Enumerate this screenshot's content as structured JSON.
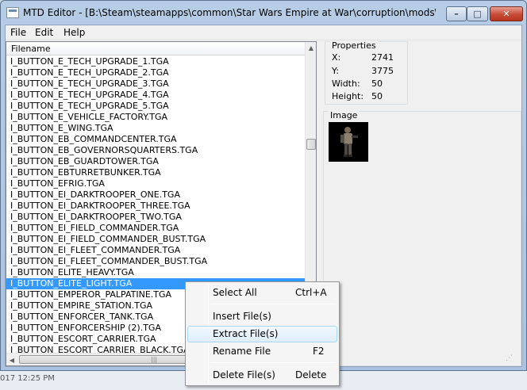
{
  "window": {
    "title": "MTD Editor -  [B:\\Steam\\steamapps\\common\\Star Wars Empire at War\\corruption\\mods\\Star_W...",
    "minimize_glyph": "–",
    "maximize_glyph": "□",
    "close_glyph": "✕"
  },
  "menu": {
    "file": "File",
    "edit": "Edit",
    "help": "Help"
  },
  "file_list": {
    "header": "Filename",
    "rows": [
      "I_BUTTON_E_TECH_UPGRADE_1.TGA",
      "I_BUTTON_E_TECH_UPGRADE_2.TGA",
      "I_BUTTON_E_TECH_UPGRADE_3.TGA",
      "I_BUTTON_E_TECH_UPGRADE_4.TGA",
      "I_BUTTON_E_TECH_UPGRADE_5.TGA",
      "I_BUTTON_E_VEHICLE_FACTORY.TGA",
      "I_BUTTON_E_WING.TGA",
      "I_BUTTON_EB_COMMANDCENTER.TGA",
      "I_BUTTON_EB_GOVERNORSQUARTERS.TGA",
      "I_BUTTON_EB_GUARDTOWER.TGA",
      "I_BUTTON_EBTURRETBUNKER.TGA",
      "I_BUTTON_EFRIG.TGA",
      "I_BUTTON_EI_DARKTROOPER_ONE.TGA",
      "I_BUTTON_EI_DARKTROOPER_THREE.TGA",
      "I_BUTTON_EI_DARKTROOPER_TWO.TGA",
      "I_BUTTON_EI_FIELD_COMMANDER.TGA",
      "I_BUTTON_EI_FIELD_COMMANDER_BUST.TGA",
      "I_BUTTON_EI_FLEET_COMMANDER.TGA",
      "I_BUTTON_EI_FLEET_COMMANDER_BUST.TGA",
      "I_BUTTON_ELITE_HEAVY.TGA",
      "I_BUTTON_ELITE_LIGHT.TGA",
      "I_BUTTON_EMPEROR_PALPATINE.TGA",
      "I_BUTTON_EMPIRE_STATION.TGA",
      "I_BUTTON_ENFORCER_TANK.TGA",
      "I_BUTTON_ENFORCERSHIP (2).TGA",
      "I_BUTTON_ESCORT_CARRIER.TGA",
      "I_BUTTON_ESCORT_CARRIER_BLACK.TGA"
    ],
    "selected_index": 20
  },
  "properties": {
    "legend": "Properties",
    "x_label": "X:",
    "x_value": "2741",
    "y_label": "Y:",
    "y_value": "3775",
    "width_label": "Width:",
    "width_value": "50",
    "height_label": "Height:",
    "height_value": "50"
  },
  "image": {
    "legend": "Image"
  },
  "context_menu": {
    "select_all": "Select All",
    "select_all_shortcut": "Ctrl+A",
    "insert_files": "Insert File(s)",
    "extract_files": "Extract File(s)",
    "rename_file": "Rename File",
    "rename_file_shortcut": "F2",
    "delete_files": "Delete File(s)",
    "delete_files_shortcut": "Delete"
  },
  "desktop": {
    "timestamp_fragment": "017 12:25 PM"
  },
  "colors": {
    "selection": "#3399ff",
    "close_button": "#c74a36",
    "menu_hover_border": "#a8d8f8"
  }
}
